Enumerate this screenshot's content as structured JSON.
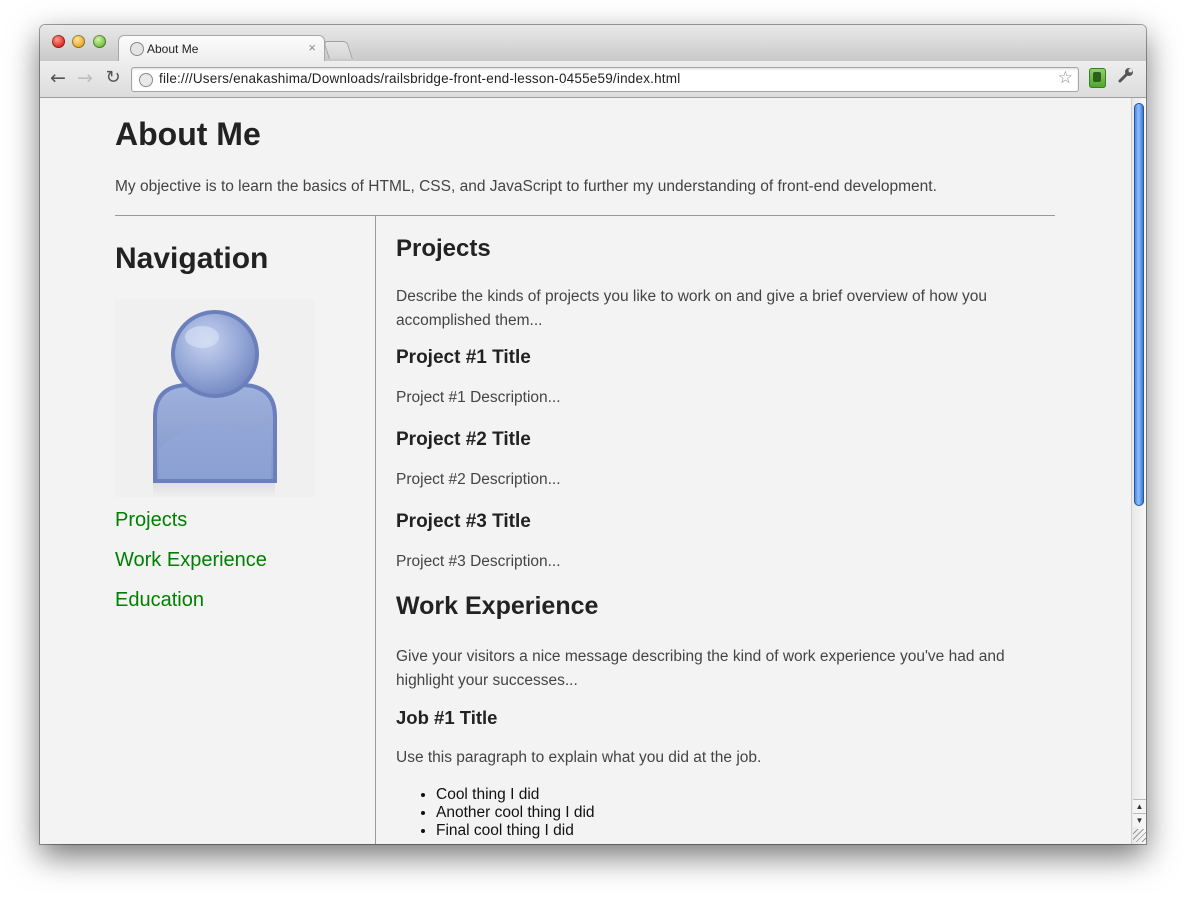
{
  "browser": {
    "tab_title": "About Me",
    "tab_close": "×",
    "url": "file:///Users/enakashima/Downloads/railsbridge-front-end-lesson-0455e59/index.html",
    "back_glyph": "←",
    "forward_glyph": "→",
    "reload_glyph": "↻",
    "star_glyph": "☆",
    "wrench_glyph": "🔧",
    "scroll_up_glyph": "▲",
    "scroll_down_glyph": "▼"
  },
  "page": {
    "title": "About Me",
    "objective": "My objective is to learn the basics of HTML, CSS, and JavaScript to further my understanding of front-end development.",
    "navigation": {
      "title": "Navigation",
      "links": [
        "Projects",
        "Work Experience",
        "Education"
      ]
    },
    "projects": {
      "title": "Projects",
      "intro": "Describe the kinds of projects you like to work on and give a brief overview of how you accomplished them...",
      "items": [
        {
          "title": "Project #1 Title",
          "description": "Project #1 Description..."
        },
        {
          "title": "Project #2 Title",
          "description": "Project #2 Description..."
        },
        {
          "title": "Project #3 Title",
          "description": "Project #3 Description..."
        }
      ]
    },
    "work": {
      "title": "Work Experience",
      "intro": "Give your visitors a nice message describing the kind of work experience you've had and highlight your successes...",
      "jobs": [
        {
          "title": "Job #1 Title",
          "description": "Use this paragraph to explain what you did at the job.",
          "bullets": [
            "Cool thing I did",
            "Another cool thing I did",
            "Final cool thing I did"
          ]
        }
      ]
    }
  },
  "colors": {
    "link": "#008000",
    "background": "#f3f3f3",
    "heading": "#222222",
    "body_text": "#444444"
  }
}
